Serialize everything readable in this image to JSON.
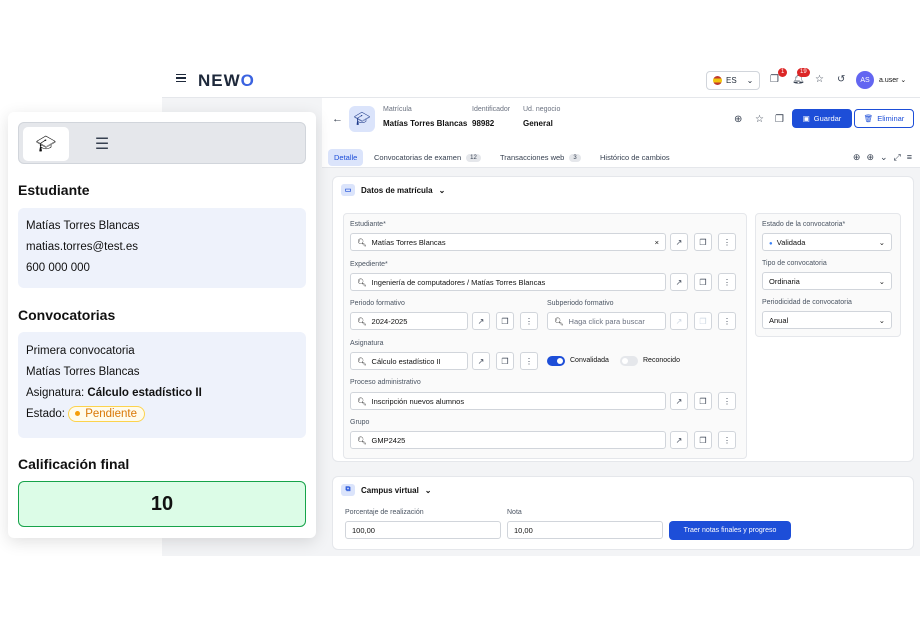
{
  "topbar": {
    "logo_a": "NEW",
    "logo_b": "O",
    "lang": "ES",
    "notif_a": "1",
    "notif_b": "19",
    "avatar": "AS",
    "user": "a.user"
  },
  "header": {
    "l1": "Matrícula",
    "v1": "Matías Torres Blancas",
    "l2": "Identificador",
    "v2": "98982",
    "l3": "Ud. negocio",
    "v3": "General",
    "save": "Guardar",
    "del": "Eliminar"
  },
  "tabs": [
    {
      "label": "Detalle"
    },
    {
      "label": "Convocatorias de examen",
      "count": "12"
    },
    {
      "label": "Transacciones web",
      "count": "3"
    },
    {
      "label": "Histórico de cambios"
    }
  ],
  "datos": {
    "title": "Datos de matrícula",
    "estudiante_lbl": "Estudiante*",
    "estudiante": "Matías Torres Blancas",
    "expediente_lbl": "Expediente*",
    "expediente": "Ingeniería de computadores / Matías Torres Blancas",
    "periodo_lbl": "Periodo formativo",
    "periodo": "2024-2025",
    "subperiodo_lbl": "Subperiodo formativo",
    "subperiodo_ph": "Haga click para buscar",
    "asignatura_lbl": "Asignatura",
    "asignatura": "Cálculo estadístico II",
    "convalidada": "Convalidada",
    "reconocido": "Reconocido",
    "proceso_lbl": "Proceso administrativo",
    "proceso": "Inscripción nuevos alumnos",
    "grupo_lbl": "Grupo",
    "grupo": "GMP2425",
    "estado_lbl": "Estado de la convocatoria*",
    "estado": "Validada",
    "tipo_lbl": "Tipo de convocatoria",
    "tipo": "Ordinaria",
    "periodicidad_lbl": "Periodicidad de convocatoria",
    "periodicidad": "Anual"
  },
  "campus": {
    "title": "Campus virtual",
    "pct_lbl": "Porcentaje de realización",
    "pct": "100,00",
    "nota_lbl": "Nota",
    "nota": "10,00",
    "traer": "Traer notas finales y progreso"
  },
  "panel": {
    "estudiante_title": "Estudiante",
    "nombre": "Matías Torres Blancas",
    "email": "matias.torres@test.es",
    "telefono": "600 000 000",
    "conv_title": "Convocatorias",
    "conv_nombre": "Primera convocatoria",
    "conv_alumno": "Matías Torres Blancas",
    "asig_lbl": "Asignatura:",
    "asig_val": "Cálculo estadístico II",
    "estado_lbl": "Estado:",
    "estado_val": "Pendiente",
    "calif_title": "Calificación final",
    "calif_val": "10"
  }
}
